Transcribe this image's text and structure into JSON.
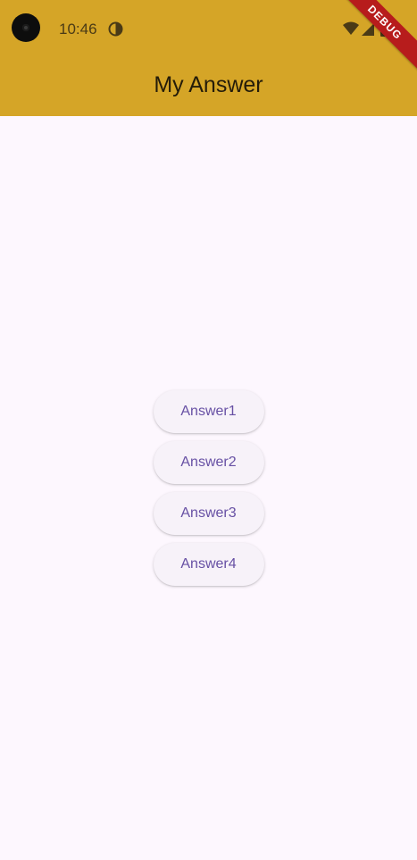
{
  "status_bar": {
    "time": "10:46",
    "icons": [
      "camera-icon",
      "data-saver-icon",
      "wifi-icon",
      "signal-icon",
      "battery-icon"
    ]
  },
  "debug_banner": "DEBUG",
  "app_bar": {
    "title": "My Answer",
    "background_color": "#d5a527"
  },
  "answers": [
    {
      "label": "Answer1"
    },
    {
      "label": "Answer2"
    },
    {
      "label": "Answer3"
    },
    {
      "label": "Answer4"
    }
  ],
  "colors": {
    "accent": "#6750a4",
    "background": "#fdf7fe"
  }
}
